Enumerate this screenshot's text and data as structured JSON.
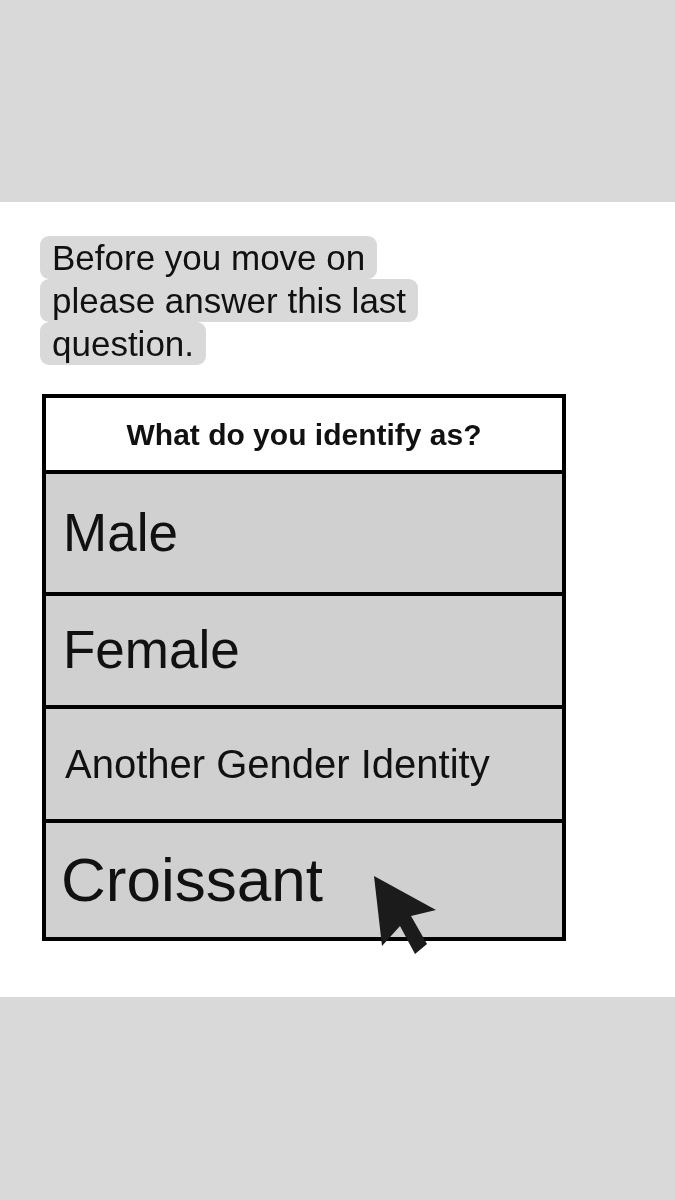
{
  "prompt": "Before you move on please answer this last question.",
  "question": {
    "title": "What do you identify as?",
    "options": [
      {
        "label": "Male"
      },
      {
        "label": "Female"
      },
      {
        "label": "Another Gender Identity"
      },
      {
        "label": "Croissant"
      }
    ]
  }
}
